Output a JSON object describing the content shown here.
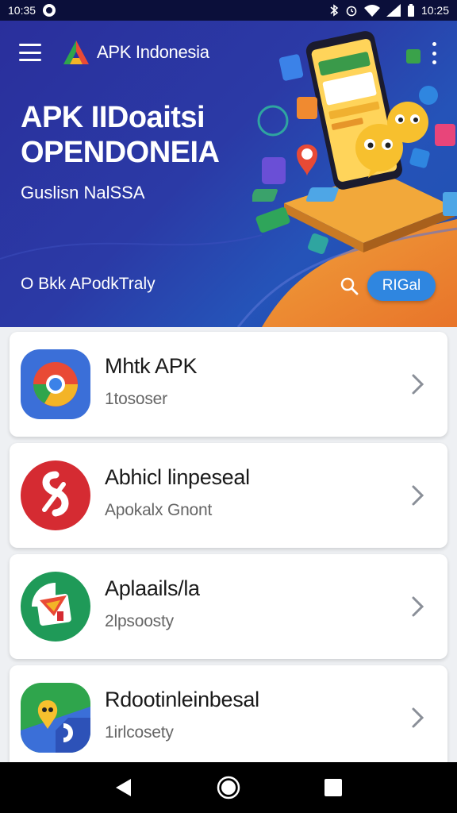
{
  "status_bar": {
    "time_left": "10:35",
    "time_right": "10:25",
    "icons": [
      "notification-icon",
      "bluetooth-icon",
      "alarm-icon",
      "wifi-icon",
      "signal-icon",
      "battery-icon"
    ]
  },
  "header": {
    "brand_name": "APK Indonesia",
    "menu_icon": "hamburger-menu-icon",
    "overflow_icon": "overflow-menu-icon"
  },
  "hero": {
    "title_line1": "APK IIDoaitsi",
    "title_line2": "OPENDONEIA",
    "subtitle": "Guslisn NalSSA",
    "footer_text": "O Bkk APodkTraly",
    "cta_label": "RIGal",
    "search_icon": "search-icon"
  },
  "apps": [
    {
      "name": "Mhtk APK",
      "subtitle": "1tososer",
      "icon": "chrome-style-app-icon",
      "icon_color": "#3b6fd8"
    },
    {
      "name": "Abhicl linpeseal",
      "subtitle": "Apokalx Gnont",
      "icon": "red-app-icon",
      "icon_color": "#d52b32"
    },
    {
      "name": "Aplaails/la",
      "subtitle": "2lpsoosty",
      "icon": "green-app-icon",
      "icon_color": "#1f9a58"
    },
    {
      "name": "Rdootinleinbesal",
      "subtitle": "1irlcosety",
      "icon": "maps-style-app-icon",
      "icon_color": "#2fa54c"
    }
  ],
  "nav_bar": {
    "back_icon": "back-icon",
    "home_icon": "home-icon",
    "recents_icon": "recents-icon"
  },
  "colors": {
    "hero_blue": "#2b3aa6",
    "hero_orange": "#ef8a2b",
    "cta_blue": "#2f86e0"
  }
}
